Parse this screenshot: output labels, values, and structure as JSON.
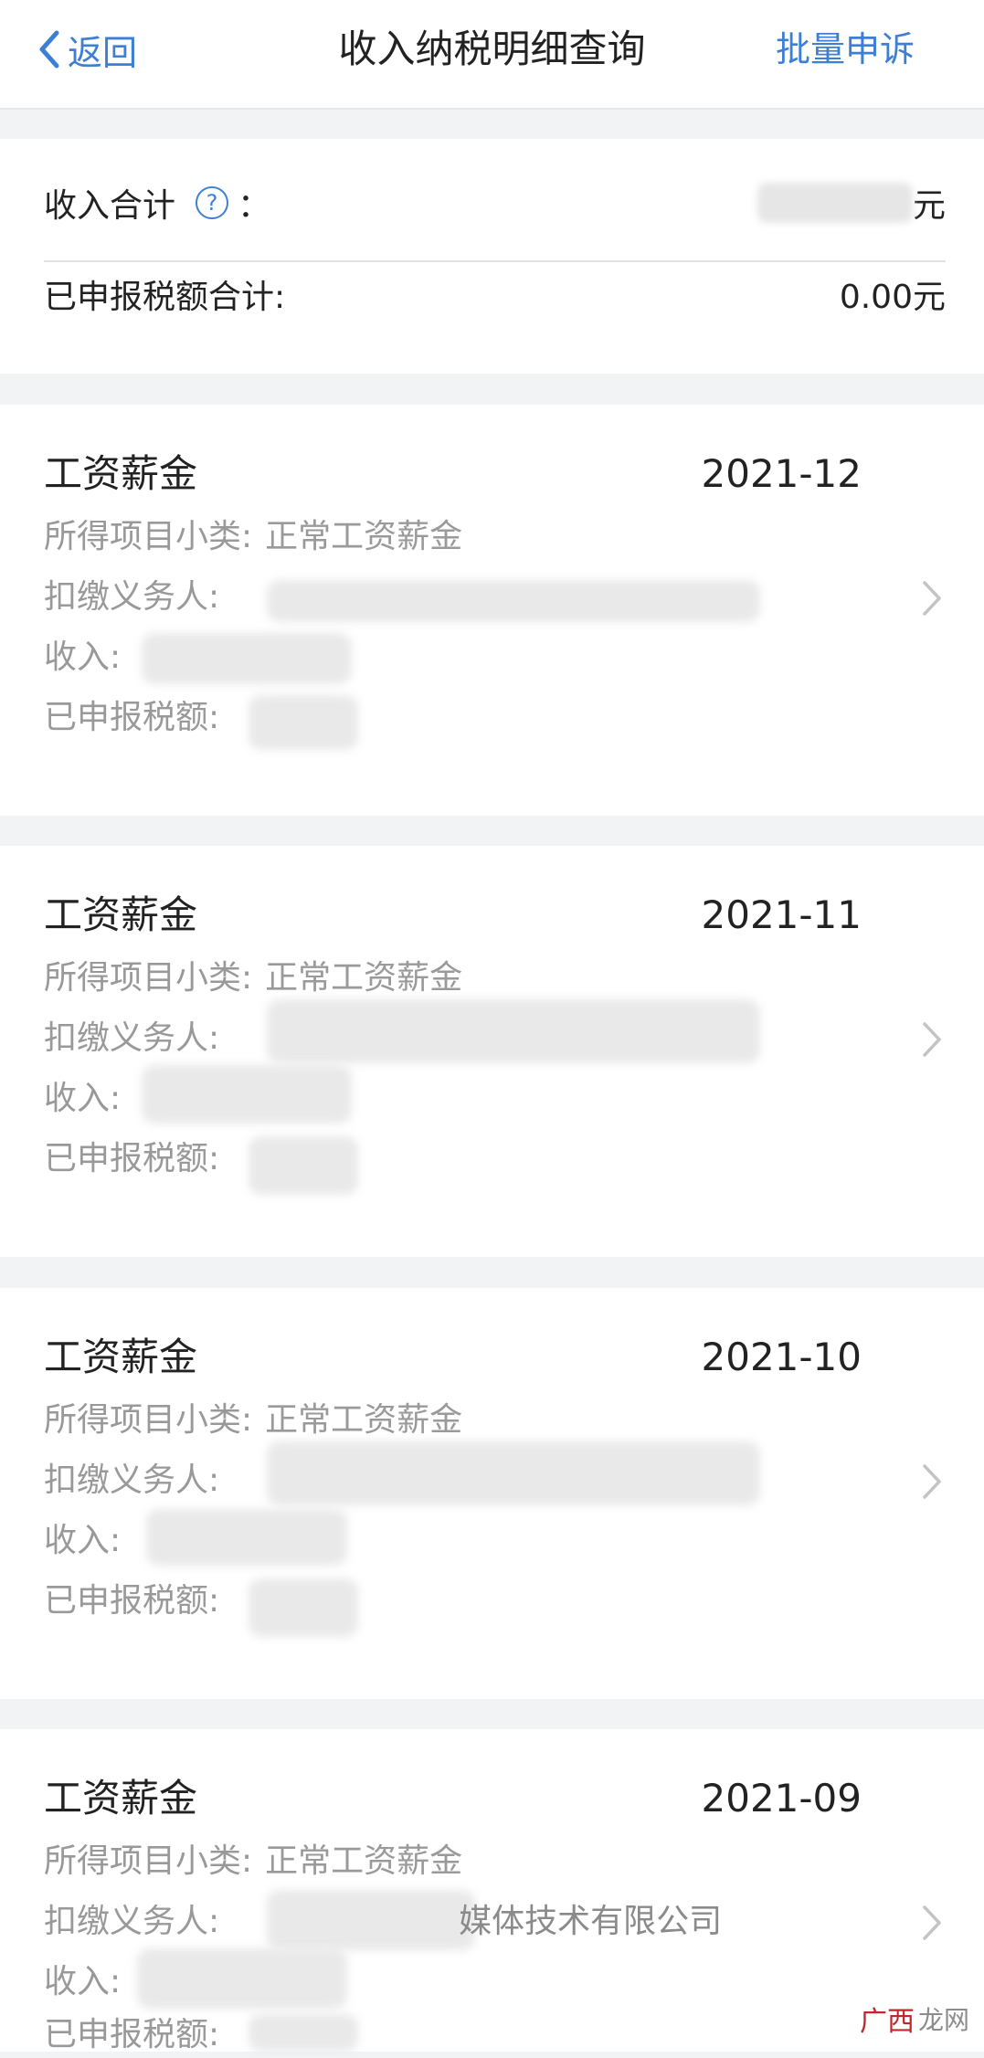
{
  "nav": {
    "back_label": "返回",
    "title": "收入纳税明细查询",
    "action_label": "批量申诉"
  },
  "summary": {
    "income_total_label": "收入合计",
    "income_total_colon": "：",
    "income_total_value": "",
    "income_total_unit": "元",
    "declared_tax_label": "已申报税额合计:",
    "declared_tax_value": "0.00元"
  },
  "records": [
    {
      "title": "工资薪金",
      "period": "2021-12",
      "subtype_label": "所得项目小类:",
      "subtype_value": "正常工资薪金",
      "withholder_label": "扣缴义务人:",
      "withholder_value": "",
      "income_label": "收入:",
      "tax_label": "已申报税额:"
    },
    {
      "title": "工资薪金",
      "period": "2021-11",
      "subtype_label": "所得项目小类:",
      "subtype_value": "正常工资薪金",
      "withholder_label": "扣缴义务人:",
      "withholder_value": "",
      "income_label": "收入:",
      "tax_label": "已申报税额:"
    },
    {
      "title": "工资薪金",
      "period": "2021-10",
      "subtype_label": "所得项目小类:",
      "subtype_value": "正常工资薪金",
      "withholder_label": "扣缴义务人:",
      "withholder_value": "",
      "income_label": "收入:",
      "tax_label": "已申报税额:"
    },
    {
      "title": "工资薪金",
      "period": "2021-09",
      "subtype_label": "所得项目小类:",
      "subtype_value": "正常工资薪金",
      "withholder_label": "扣缴义务人:",
      "withholder_value": "媒体技术有限公司",
      "income_label": "收入:",
      "tax_label": "已申报税额:"
    }
  ],
  "watermark": {
    "text": "龙网",
    "mark": "广西"
  },
  "colors": {
    "accent": "#3e7fd6",
    "background": "#f2f3f5"
  }
}
